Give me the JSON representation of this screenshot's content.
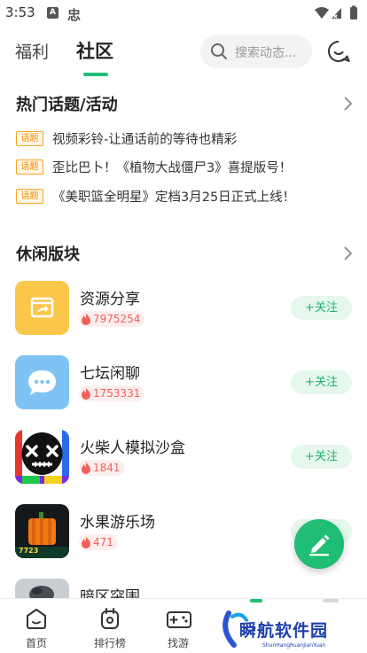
{
  "status_bar": {
    "time": "3:53",
    "indicator_a": "A",
    "indicator_b": "忠"
  },
  "top_nav": {
    "tabs": [
      {
        "label": "福利",
        "active": false
      },
      {
        "label": "社区",
        "active": true
      }
    ],
    "search_placeholder": "搜索动态...",
    "accent_color": "#1fbe74"
  },
  "hot_topics": {
    "title": "热门话题/活动",
    "items": [
      {
        "tag": "话题",
        "text": "视频彩铃-让通话前的等待也精彩"
      },
      {
        "tag": "话题",
        "text": "歪比巴卜！《植物大战僵尸3》喜提版号！"
      },
      {
        "tag": "话题",
        "text": "《美职篮全明星》定档3月25日正式上线！"
      }
    ]
  },
  "leisure": {
    "title": "休闲版块",
    "follow_label": "+关注",
    "boards": [
      {
        "name": "资源分享",
        "heat": "7975254",
        "icon": "share-box-icon"
      },
      {
        "name": "七坛闲聊",
        "heat": "1753331",
        "icon": "chat-bubble-icon"
      },
      {
        "name": "火柴人模拟沙盒",
        "heat": "1841",
        "icon": "skull-face-icon"
      },
      {
        "name": "水果游乐场",
        "heat": "471",
        "icon": "pumpkin-icon",
        "thumb_caption": "7723"
      },
      {
        "name": "暗区突围",
        "heat": "",
        "icon": "soldier-icon"
      }
    ]
  },
  "bottom_nav": [
    {
      "label": "首页",
      "icon": "home-icon"
    },
    {
      "label": "排行榜",
      "icon": "ranking-icon"
    },
    {
      "label": "找游",
      "icon": "gamepad-icon"
    }
  ],
  "watermark": {
    "text": "瞬航软件园",
    "sub": "ShunHangRuanJianYuan"
  }
}
